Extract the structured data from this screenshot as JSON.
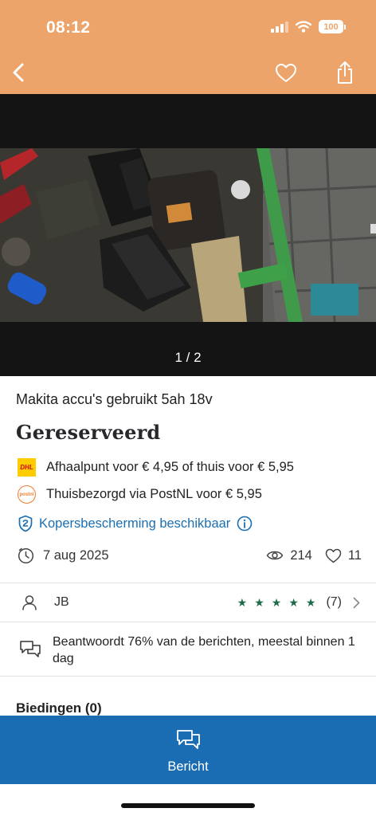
{
  "status_bar": {
    "time": "08:12",
    "battery": "100"
  },
  "header": {
    "back_icon": "chevron-left-icon",
    "favorite_icon": "heart-icon",
    "share_icon": "share-icon",
    "background": "#eda46a"
  },
  "gallery": {
    "counter": "1 / 2"
  },
  "listing": {
    "title": "Makita accu's gebruikt 5ah 18v",
    "status": "Gereserveerd",
    "shipping": [
      {
        "carrier_icon": "dhl-logo",
        "text": "Afhaalpunt voor € 4,95 of thuis voor € 5,95"
      },
      {
        "carrier_icon": "postnl-logo",
        "text": "Thuisbezorgd via PostNL voor € 5,95"
      }
    ],
    "buyer_protection": "Kopersbescherming beschikbaar",
    "date": "7 aug 2025",
    "views": "214",
    "favorites": "11"
  },
  "seller": {
    "name": "JB",
    "rating_stars": 5,
    "rating_count": "(7)",
    "response_text": "Beantwoordt 76% van de berichten, meestal binnen 1 dag"
  },
  "bids": {
    "title": "Biedingen (0)"
  },
  "bottom_bar": {
    "label": "Bericht",
    "background": "#1a6db3"
  },
  "colors": {
    "link_blue": "#1b6fb0",
    "star_green": "#1e6b4a"
  }
}
